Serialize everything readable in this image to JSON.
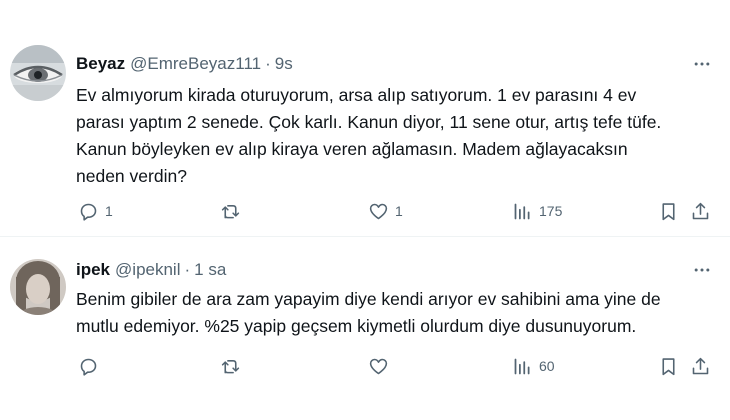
{
  "tweets": [
    {
      "name": "Beyaz",
      "handle": "@EmreBeyaz111",
      "separator": "·",
      "time": "9s",
      "text_lines": [
        "Ev almıyorum kirada oturuyorum, arsa alıp satıyorum. 1 ev parasını 4 ev",
        "parası yaptım 2 senede.  Çok karlı. Kanun diyor, 11 sene otur, artış tefe tüfe.",
        "Kanun böyleyken ev alıp kiraya veren ağlamasın. Madem ağlayacaksın",
        "neden verdin?"
      ],
      "replies": "1",
      "retweets": "",
      "likes": "1",
      "views": "175"
    },
    {
      "name": "ipek",
      "handle": "@ipeknil",
      "separator": "·",
      "time": "1 sa",
      "text_lines": [
        "Benim gibiler de ara zam yapayim diye kendi arıyor ev sahibini ama yine de",
        "mutlu edemiyor. %25 yapip geçsem kiymetli olurdum diye dusunuyorum."
      ],
      "replies": "",
      "retweets": "",
      "likes": "",
      "views": "60"
    }
  ],
  "icons": {
    "more": "more-horizontal-icon",
    "reply": "reply-bubble-icon",
    "retweet": "retweet-icon",
    "like": "heart-icon",
    "views": "views-bar-chart-icon",
    "bookmark": "bookmark-icon",
    "share": "share-icon"
  },
  "colors": {
    "text": "#0f1419",
    "secondary": "#536471",
    "divider": "#eff3f4"
  }
}
